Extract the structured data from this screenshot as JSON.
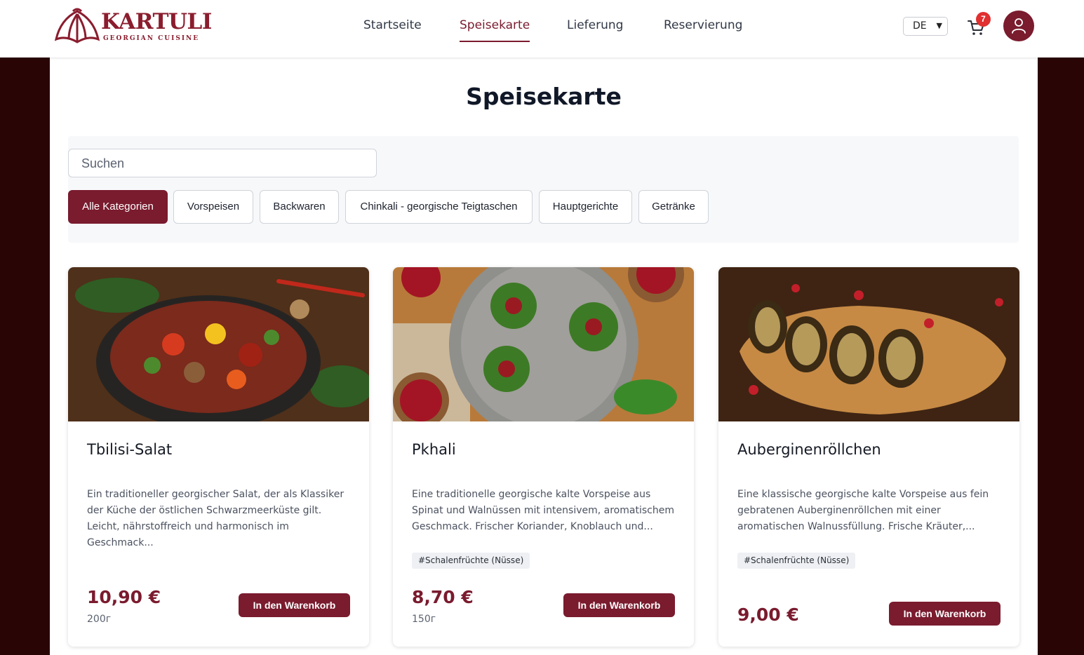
{
  "brand": {
    "name": "KARTULI",
    "tagline": "GEORGIAN CUISINE",
    "color": "#7a1b2e"
  },
  "nav": {
    "items": [
      {
        "label": "Startseite",
        "active": false
      },
      {
        "label": "Speisekarte",
        "active": true
      },
      {
        "label": "Lieferung",
        "active": false
      },
      {
        "label": "Reservierung",
        "active": false
      }
    ]
  },
  "header": {
    "language": "DE",
    "cart_icon": "shopping-cart-icon",
    "cart_count": "7",
    "avatar_icon": "user-icon"
  },
  "page": {
    "title": "Speisekarte"
  },
  "search": {
    "placeholder": "Suchen"
  },
  "categories": [
    {
      "label": "Alle Kategorien",
      "active": true
    },
    {
      "label": "Vorspeisen",
      "active": false
    },
    {
      "label": "Backwaren",
      "active": false
    },
    {
      "label": "Chinkali - georgische Teigtaschen",
      "active": false
    },
    {
      "label": "Hauptgerichte",
      "active": false
    },
    {
      "label": "Getränke",
      "active": false
    }
  ],
  "dishes": [
    {
      "name": "Tbilisi-Salat",
      "description": "Ein traditioneller georgischer Salat, der als Klassiker der Küche der östlichen Schwarzmeerküste gilt. Leicht, nährstoffreich und harmonisch im Geschmack...",
      "tag": "",
      "price": "10,90 €",
      "weight": "200г",
      "button": "In den Warenkorb"
    },
    {
      "name": "Pkhali",
      "description": "Eine traditionelle georgische kalte Vorspeise aus Spinat und Walnüssen mit intensivem, aromatischem Geschmack. Frischer Koriander, Knoblauch und...",
      "tag": "#Schalenfrüchte (Nüsse)",
      "price": "8,70 €",
      "weight": "150г",
      "button": "In den Warenkorb"
    },
    {
      "name": "Auberginenröllchen",
      "description": "Eine klassische georgische kalte Vorspeise aus fein gebratenen Auberginenröllchen mit einer aromatischen Walnussfüllung. Frische Kräuter,...",
      "tag": "#Schalenfrüchte (Nüsse)",
      "price": "9,00 €",
      "weight": "",
      "button": "In den Warenkorb"
    }
  ]
}
